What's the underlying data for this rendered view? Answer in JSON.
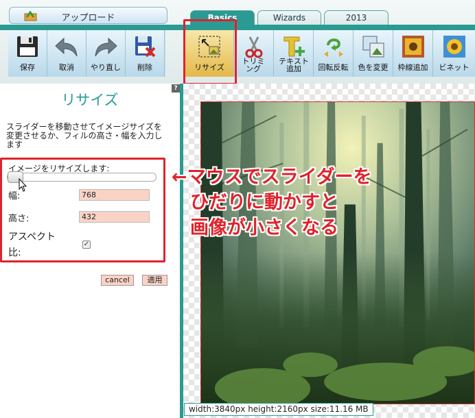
{
  "upload_button": {
    "label": "アップロード"
  },
  "tabs": [
    {
      "label": "Basics"
    },
    {
      "label": "Wizards"
    },
    {
      "label": "2013"
    }
  ],
  "toolbar_left": [
    {
      "label": "保存",
      "icon": "floppy-disk-icon"
    },
    {
      "label": "取消",
      "icon": "undo-arrow-icon"
    },
    {
      "label": "やり直し",
      "icon": "redo-arrow-icon"
    },
    {
      "label": "削除",
      "icon": "delete-image-icon"
    }
  ],
  "toolbar_right": [
    {
      "label": "リサイズ",
      "icon": "resize-icon",
      "active": true
    },
    {
      "label": "トリミング",
      "icon": "scissors-icon"
    },
    {
      "label": "テキスト追加",
      "icon": "add-text-icon"
    },
    {
      "label": "回転反転",
      "icon": "rotate-flip-icon"
    },
    {
      "label": "色を変更",
      "icon": "change-color-icon"
    },
    {
      "label": "枠線追加",
      "icon": "add-border-icon"
    },
    {
      "label": "ビネット",
      "icon": "vignette-icon"
    }
  ],
  "panel": {
    "title": "リサイズ",
    "help": "?",
    "description": "スライダーを移動させてイメージサイズを変更させるか、フィルの高さ・幅を入力します",
    "slider_label": "イメージをリサイズします:",
    "slider_value": 0.05,
    "width_label": "幅:",
    "width_value": "768",
    "height_label": "高さ:",
    "height_value": "432",
    "aspect_label": "アスペクト比:",
    "aspect_checked": true,
    "cancel_label": "cancel",
    "apply_label": "適用"
  },
  "info": {
    "text": "width:3840px  height:2160px  size:11.16 MB"
  },
  "annotation": {
    "line1": "←マウスでスライダーを",
    "line2": "ひだりに動かすと",
    "line3": "画像が小さくなる"
  },
  "colors": {
    "teal": "#2b9a93",
    "highlight_red": "#e0222b",
    "input_peach": "#fbd3c6"
  }
}
